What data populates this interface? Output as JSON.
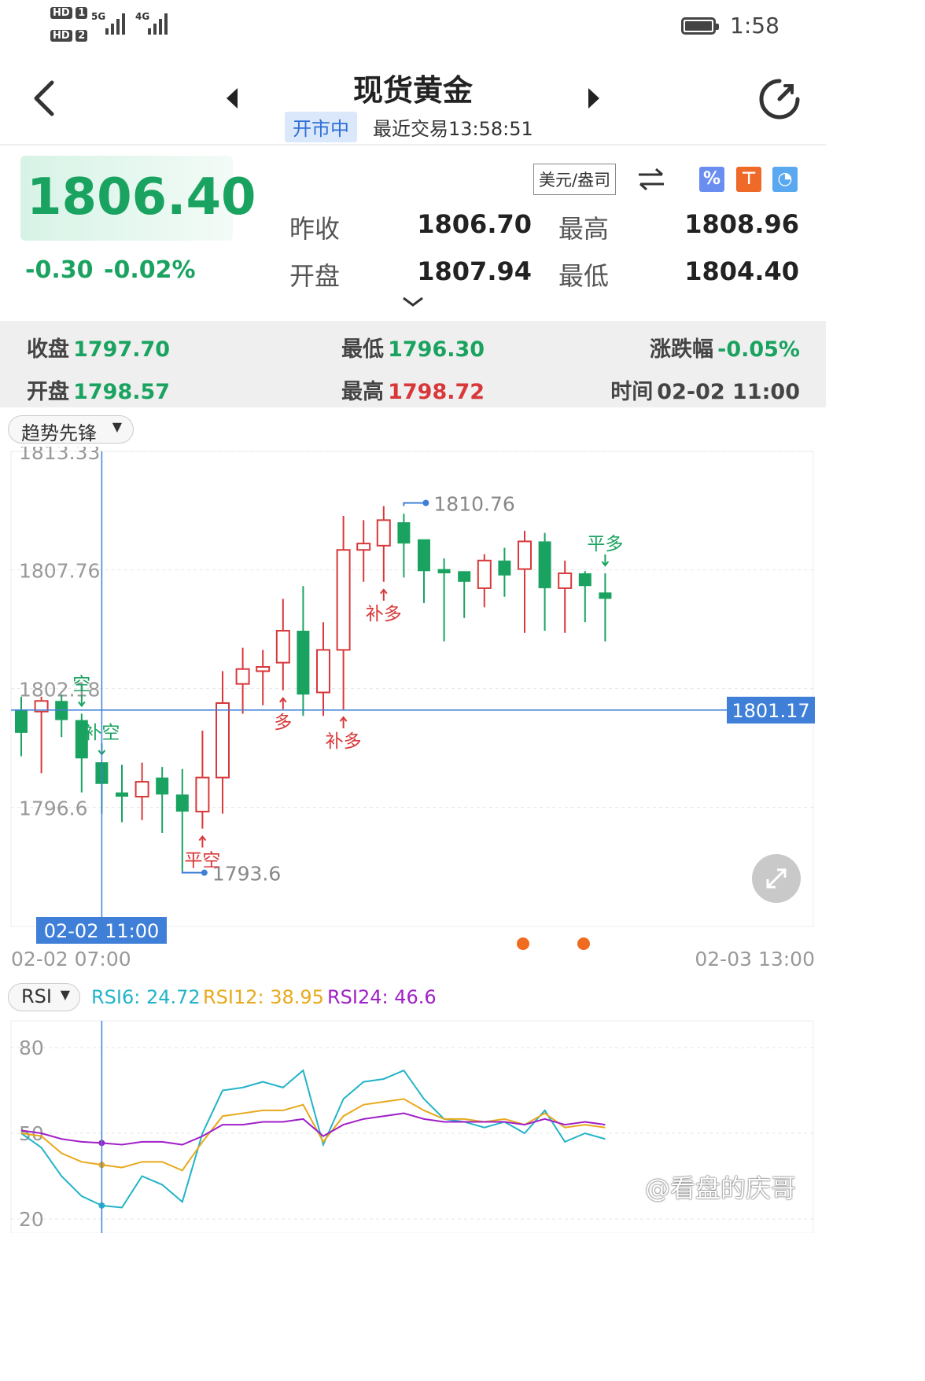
{
  "status_bar": {
    "sim1": "HD",
    "sim1_slot": "1",
    "sim2": "HD",
    "sim2_slot": "2",
    "net1": "5G",
    "net2": "4G",
    "time": "1:58"
  },
  "header": {
    "title": "现货黄金",
    "market_status": "开市中",
    "last_trade": "最近交易13:58:51"
  },
  "quote": {
    "price": "1806.40",
    "change": "-0.30",
    "change_pct": "-0.02%",
    "unit": "美元/盎司",
    "rows": [
      {
        "l1": "昨收",
        "v1": "1806.70",
        "l2": "最高",
        "v2": "1808.96"
      },
      {
        "l1": "开盘",
        "v1": "1807.94",
        "l2": "最低",
        "v2": "1804.40"
      }
    ]
  },
  "candle_info": {
    "close_label": "收盘",
    "close": "1797.70",
    "low_label": "最低",
    "low": "1796.30",
    "pct_label": "涨跌幅",
    "pct": "-0.05%",
    "open_label": "开盘",
    "open": "1798.57",
    "high_label": "最高",
    "high": "1798.72",
    "time_label": "时间",
    "time": "02-02 11:00"
  },
  "selectors": {
    "main_indicator": "趋势先锋",
    "sub_indicator": "RSI"
  },
  "rsi_values": {
    "rsi6": "RSI6: 24.72",
    "rsi12": "RSI12: 38.95",
    "rsi24": "RSI24: 46.6"
  },
  "colors": {
    "up": "#d8383a",
    "down": "#1aa360",
    "crosshair": "#3f7fd8",
    "rsi6": "#22b3c8",
    "rsi12": "#e8a91c",
    "rsi24": "#a020c8"
  },
  "chart_data": [
    {
      "type": "candlestick",
      "y_ticks": [
        "1813.33",
        "1807.76",
        "1802.18",
        "1796.6"
      ],
      "ylim": [
        1791.0,
        1813.33
      ],
      "x_start_label": "02-02 07:00",
      "x_end_label": "02-03 13:00",
      "crosshair_x_label": "02-02 11:00",
      "crosshair_y_label": "1801.17",
      "crosshair_y": 1801.17,
      "crosshair_index": 4,
      "max_label": "1810.76",
      "min_label": "1793.6",
      "max_index": 19,
      "min_index": 8,
      "candles": [
        [
          1801.2,
          1800.1,
          1801.8,
          1799.0
        ],
        [
          1801.1,
          1801.6,
          1801.8,
          1798.2
        ],
        [
          1801.6,
          1800.7,
          1801.9,
          1799.9
        ],
        [
          1800.7,
          1798.9,
          1801.0,
          1797.3
        ],
        [
          1798.72,
          1797.7,
          1798.72,
          1796.3
        ],
        [
          1797.3,
          1797.1,
          1798.6,
          1795.9
        ],
        [
          1797.1,
          1797.8,
          1798.7,
          1796.0
        ],
        [
          1798.0,
          1797.2,
          1798.5,
          1795.4
        ],
        [
          1797.2,
          1796.4,
          1798.4,
          1793.6
        ],
        [
          1796.4,
          1798.0,
          1800.2,
          1795.6
        ],
        [
          1798.0,
          1801.5,
          1803.0,
          1796.3
        ],
        [
          1802.4,
          1803.1,
          1804.1,
          1801.0
        ],
        [
          1803.0,
          1803.2,
          1804.0,
          1801.4
        ],
        [
          1803.4,
          1804.9,
          1806.4,
          1802.1
        ],
        [
          1804.9,
          1801.9,
          1807.0,
          1800.9
        ],
        [
          1802.0,
          1804.0,
          1805.3,
          1800.9
        ],
        [
          1804.0,
          1808.7,
          1810.3,
          1801.2
        ],
        [
          1808.7,
          1809.0,
          1810.1,
          1807.2
        ],
        [
          1808.9,
          1810.1,
          1810.76,
          1807.2
        ],
        [
          1810.0,
          1809.0,
          1810.4,
          1807.4
        ],
        [
          1809.2,
          1807.7,
          1808.3,
          1806.2
        ],
        [
          1807.8,
          1807.6,
          1808.3,
          1804.4
        ],
        [
          1807.7,
          1807.2,
          1807.6,
          1805.5
        ],
        [
          1806.9,
          1808.2,
          1808.5,
          1806.0
        ],
        [
          1808.2,
          1807.5,
          1808.8,
          1806.5
        ],
        [
          1807.8,
          1809.1,
          1809.6,
          1804.8
        ],
        [
          1809.1,
          1806.9,
          1809.5,
          1804.9
        ],
        [
          1806.9,
          1807.6,
          1808.2,
          1804.8
        ],
        [
          1807.6,
          1807.0,
          1807.7,
          1805.3
        ],
        [
          1806.7,
          1806.4,
          1807.6,
          1804.4
        ]
      ],
      "signals": [
        {
          "text": "空",
          "index": 3,
          "color": "green",
          "pos": "above"
        },
        {
          "text": "补空",
          "index": 4,
          "color": "green",
          "pos": "above"
        },
        {
          "text": "平空",
          "index": 9,
          "color": "red",
          "pos": "below"
        },
        {
          "text": "多",
          "index": 13,
          "color": "red",
          "pos": "below"
        },
        {
          "text": "补多",
          "index": 16,
          "color": "red",
          "pos": "below"
        },
        {
          "text": "补多",
          "index": 18,
          "color": "red",
          "pos": "below"
        },
        {
          "text": "平多",
          "index": 29,
          "color": "green",
          "pos": "above"
        }
      ]
    },
    {
      "type": "line",
      "title": "RSI",
      "y_ticks": [
        "80",
        "50",
        "20"
      ],
      "ylim": [
        20,
        80
      ],
      "series": [
        {
          "name": "RSI6",
          "values": [
            50,
            45,
            35,
            28,
            24.72,
            24,
            35,
            32,
            26,
            50,
            65,
            66,
            68,
            66,
            72,
            46,
            62,
            68,
            69,
            72,
            62,
            55,
            54,
            52,
            54,
            50,
            58,
            47,
            50,
            48
          ]
        },
        {
          "name": "RSI12",
          "values": [
            50,
            49,
            43,
            40,
            38.95,
            38,
            40,
            40,
            37,
            47,
            56,
            57,
            58,
            58,
            60,
            47,
            56,
            60,
            61,
            62,
            58,
            55,
            55,
            54,
            55,
            53,
            57,
            52,
            53,
            52
          ]
        },
        {
          "name": "RSI24",
          "values": [
            51,
            50,
            48,
            47,
            46.6,
            46,
            47,
            47,
            46,
            49,
            53,
            53,
            54,
            54,
            55,
            49,
            53,
            55,
            56,
            57,
            55,
            54,
            54,
            54,
            54,
            53,
            55,
            53,
            54,
            53
          ]
        }
      ]
    }
  ],
  "watermark": "@看盘的庆哥"
}
